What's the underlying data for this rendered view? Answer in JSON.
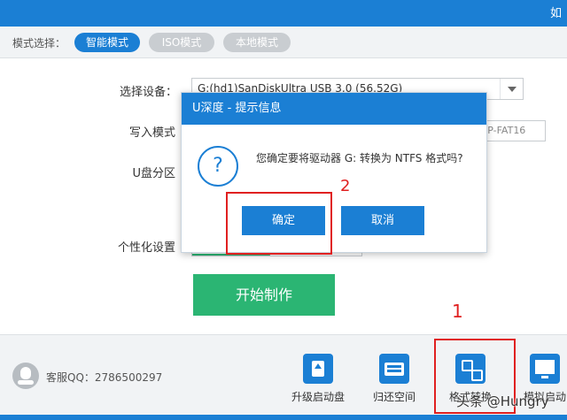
{
  "titlebar": {
    "partial_text": "如"
  },
  "modebar": {
    "label": "模式选择：",
    "modes": [
      {
        "label": "智能模式",
        "active": true
      },
      {
        "label": "ISO模式",
        "active": false
      },
      {
        "label": "本地模式",
        "active": false
      }
    ]
  },
  "form": {
    "device_label": "选择设备：",
    "device_value": "G:(hd1)SanDiskUltra USB 3.0 (56.52G)",
    "write_mode_label": "写入模式",
    "fs_value": "IP-FAT16",
    "partition_label": "U盘分区",
    "personalize_label": "个性化设置",
    "start_button": "开始制作"
  },
  "dialog": {
    "title": "U深度 - 提示信息",
    "message": "您确定要将驱动器 G: 转换为 NTFS 格式吗?",
    "confirm": "确定",
    "cancel": "取消",
    "icon": "question-icon"
  },
  "annotations": {
    "num1": "1",
    "num2": "2"
  },
  "footer": {
    "qq_label": "客服QQ：2786500297",
    "tools": [
      {
        "label": "升级启动盘",
        "icon": "upgrade-usb-icon"
      },
      {
        "label": "归还空间",
        "icon": "restore-space-icon"
      },
      {
        "label": "格式转换",
        "icon": "format-convert-icon"
      },
      {
        "label": "模拟启动",
        "icon": "simulate-boot-icon"
      }
    ]
  },
  "watermark": "头条 @Hungry",
  "colors": {
    "accent": "#1b7fd4",
    "green": "#2bb573",
    "annotation": "#e02020"
  }
}
